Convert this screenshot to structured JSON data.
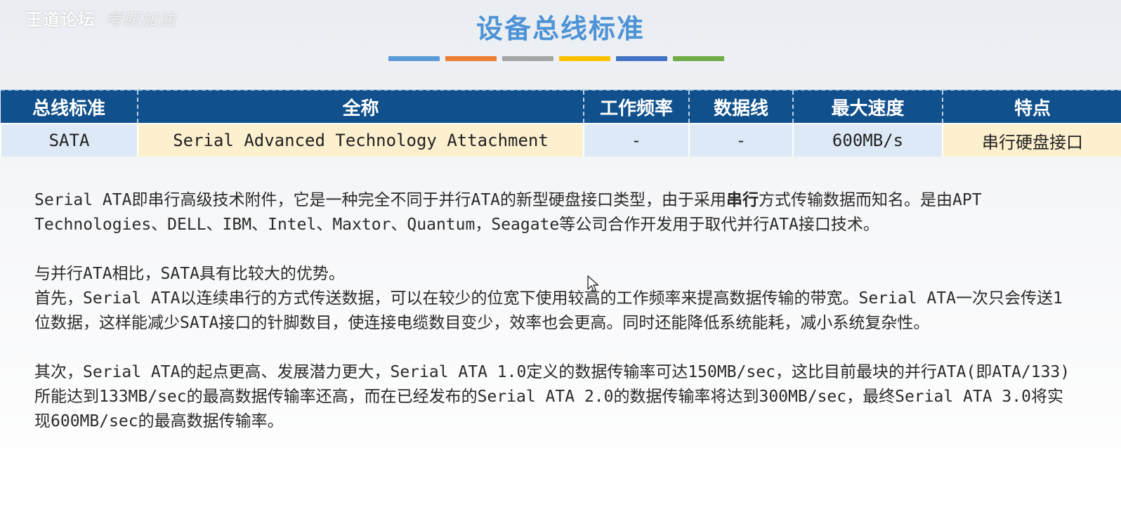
{
  "watermark": {
    "main": "王道论坛",
    "faded": "考研加油"
  },
  "slide": {
    "title": "设备总线标准"
  },
  "colors": {
    "title": "#4d93d6",
    "stripes": [
      "#5b9bd5",
      "#ed7d31",
      "#a5a5a5",
      "#ffc000",
      "#4472c4",
      "#70ad47"
    ],
    "header_bg": "#10508c",
    "cell_blue": "#dde9f6",
    "cell_cream": "#fdf0cf"
  },
  "table": {
    "headers": [
      "总线标准",
      "全称",
      "工作频率",
      "数据线",
      "最大速度",
      "特点"
    ],
    "rows": [
      [
        "SATA",
        "Serial Advanced Technology Attachment",
        "-",
        "-",
        "600MB/s",
        "串行硬盘接口"
      ]
    ]
  },
  "paragraphs": [
    {
      "pre": "Serial ATA即串行高级技术附件，它是一种完全不同于并行ATA的新型硬盘接口类型，由于采用",
      "bold": "串行",
      "post": "方式传输数据而知名。是由APT Technologies、DELL、IBM、Intel、Maxtor、Quantum，Seagate等公司合作开发用于取代并行ATA接口技术。"
    },
    {
      "text": "与并行ATA相比，SATA具有比较大的优势。\n首先，Serial ATA以连续串行的方式传送数据，可以在较少的位宽下使用较高的工作频率来提高数据传输的带宽。Serial ATA一次只会传送1位数据，这样能减少SATA接口的针脚数目，使连接电缆数目变少，效率也会更高。同时还能降低系统能耗，减小系统复杂性。"
    },
    {
      "text": "其次，Serial ATA的起点更高、发展潜力更大，Serial ATA 1.0定义的数据传输率可达150MB/sec，这比目前最块的并行ATA(即ATA/133)所能达到133MB/sec的最高数据传输率还高，而在已经发布的Serial ATA 2.0的数据传输率将达到300MB/sec，最终Serial ATA 3.0将实现600MB/sec的最高数据传输率。"
    }
  ]
}
